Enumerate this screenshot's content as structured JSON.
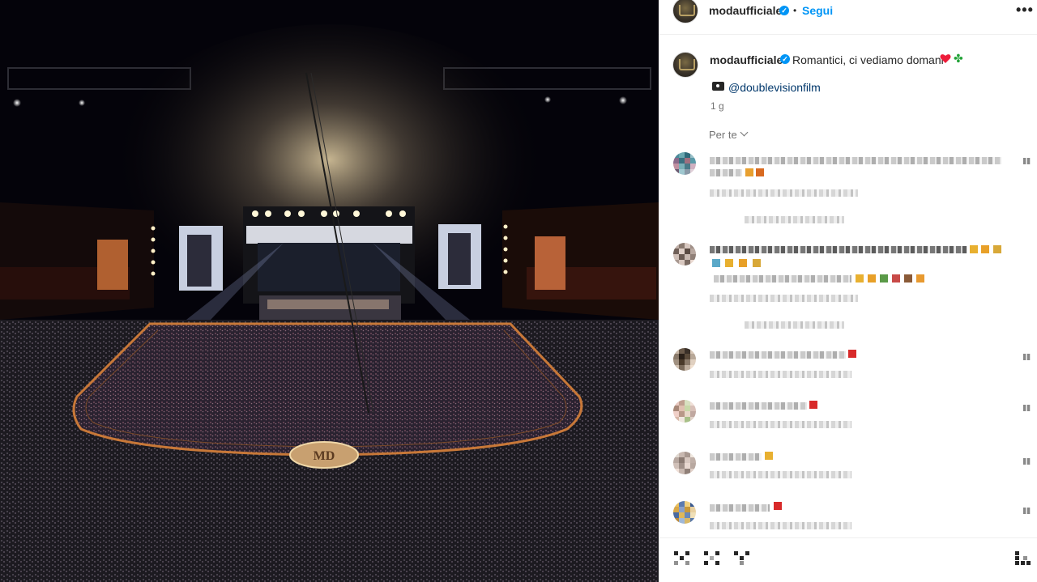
{
  "post": {
    "username": "modaufficiale",
    "follow_label": "Segui",
    "separator": "•",
    "more_label": "•••",
    "caption_text": "Romantici, ci vediamo domani",
    "credit_mention": "@doublevisionfilm",
    "time_ago": "1 g",
    "sort_label": "Per te"
  },
  "colors": {
    "accent": "#0095f6",
    "mention": "#00376b",
    "heart": "#ed1c3a",
    "clover": "#23a338"
  },
  "icons": [
    "verified-badge-icon",
    "more-options-icon",
    "heart-emoji-icon",
    "four-leaf-clover-emoji-icon",
    "camera-emoji-icon",
    "chevron-down-icon",
    "like-comment-icon",
    "share-icon",
    "save-icon"
  ],
  "comments_note": "pixelated"
}
